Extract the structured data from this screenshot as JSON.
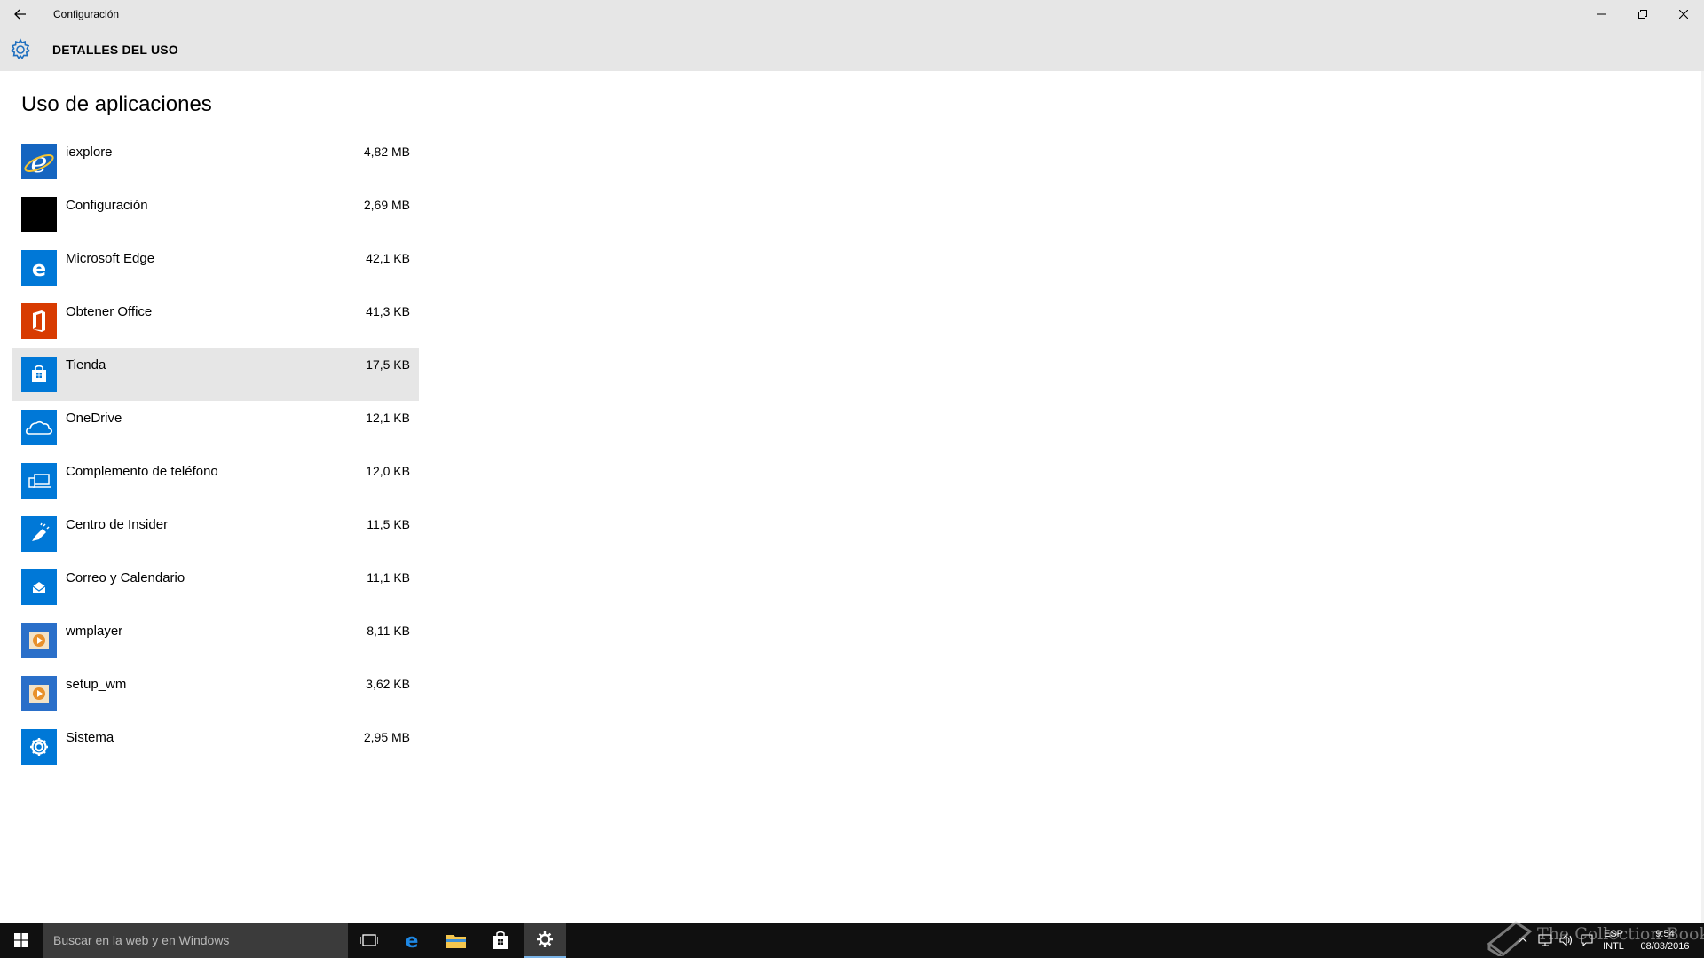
{
  "window": {
    "title": "Configuración"
  },
  "header": {
    "title": "DETALLES DEL USO",
    "icon": "gear-icon"
  },
  "section": {
    "title": "Uso de aplicaciones"
  },
  "apps": [
    {
      "name": "iexplore",
      "size": "4,82 MB",
      "icon": "internet-explorer-icon",
      "color": "#1565c0"
    },
    {
      "name": "Configuración",
      "size": "2,69 MB",
      "icon": "settings-app-icon",
      "color": "#000000"
    },
    {
      "name": "Microsoft Edge",
      "size": "42,1 KB",
      "icon": "edge-icon",
      "color": "#0078d7"
    },
    {
      "name": "Obtener Office",
      "size": "41,3 KB",
      "icon": "office-icon",
      "color": "#d83b01"
    },
    {
      "name": "Tienda",
      "size": "17,5 KB",
      "icon": "store-icon",
      "color": "#0078d7",
      "selected": true
    },
    {
      "name": "OneDrive",
      "size": "12,1 KB",
      "icon": "onedrive-icon",
      "color": "#0078d7"
    },
    {
      "name": "Complemento de teléfono",
      "size": "12,0 KB",
      "icon": "phone-companion-icon",
      "color": "#0078d7"
    },
    {
      "name": "Centro de Insider",
      "size": "11,5 KB",
      "icon": "insider-hub-icon",
      "color": "#0078d7"
    },
    {
      "name": "Correo y Calendario",
      "size": "11,1 KB",
      "icon": "mail-calendar-icon",
      "color": "#0078d7"
    },
    {
      "name": "wmplayer",
      "size": "8,11 KB",
      "icon": "media-player-icon",
      "color": "#2a6fc9"
    },
    {
      "name": "setup_wm",
      "size": "3,62 KB",
      "icon": "media-player-icon",
      "color": "#2a6fc9"
    },
    {
      "name": "Sistema",
      "size": "2,95 MB",
      "icon": "system-gear-icon",
      "color": "#0078d7"
    }
  ],
  "taskbar": {
    "search_placeholder": "Buscar en la web y en Windows",
    "language": "ESP",
    "keyboard": "INTL",
    "time": "9:54",
    "date": "08/03/2016"
  },
  "watermark": {
    "text": "The Collection Book"
  },
  "colors": {
    "accent": "#0078d7",
    "chrome": "#e6e6e6",
    "taskbar": "#101010"
  }
}
